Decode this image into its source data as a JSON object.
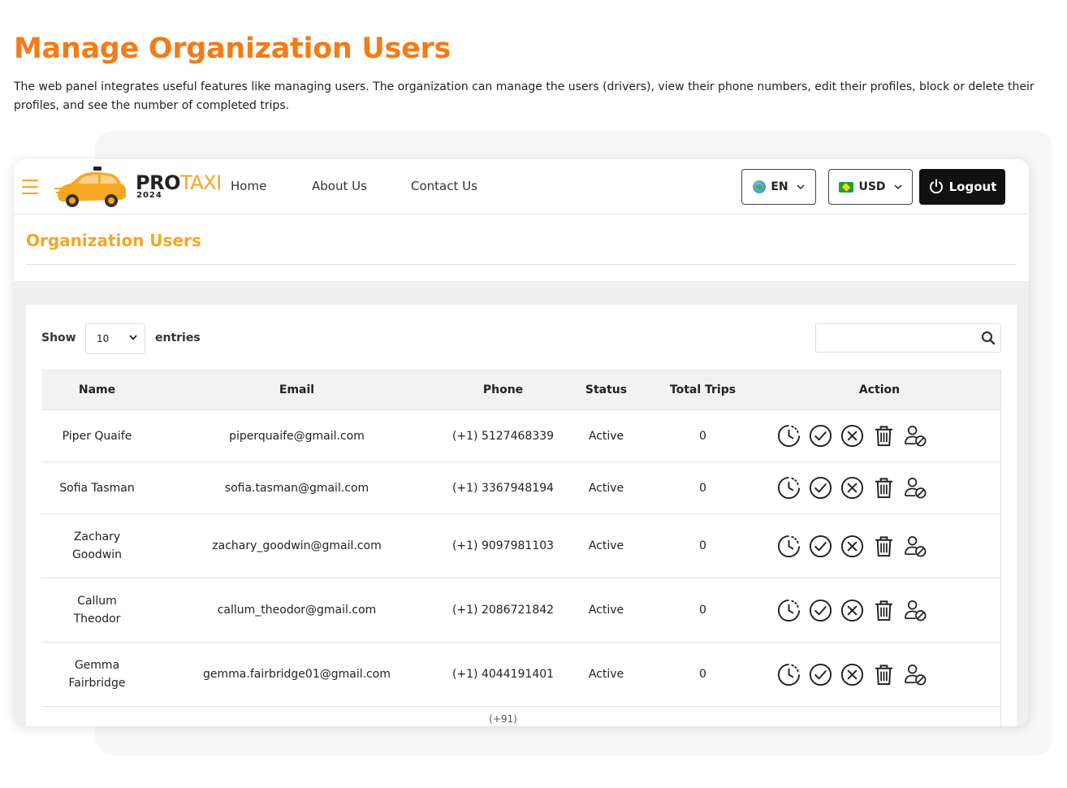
{
  "hero": {
    "title": "Manage Organization Users",
    "description": "The web panel integrates useful features like managing users. The organization can manage the users (drivers), view their phone numbers, edit their profiles, block or delete their profiles, and see the number of completed trips."
  },
  "navbar": {
    "logo_pro": "PRO",
    "logo_taxi": "TAXI",
    "logo_year": "2024",
    "links": [
      "Home",
      "About Us",
      "Contact Us"
    ],
    "language": "EN",
    "currency": "USD",
    "logout_label": "Logout"
  },
  "page": {
    "title": "Organization Users"
  },
  "table_controls": {
    "show_label": "Show",
    "entries_value": "10",
    "entries_label": "entries",
    "search_value": ""
  },
  "table": {
    "headers": [
      "Name",
      "Email",
      "Phone",
      "Status",
      "Total Trips",
      "Action"
    ],
    "rows": [
      {
        "name": "Piper Quaife",
        "email": "piperquaife@gmail.com",
        "phone": "(+1) 5127468339",
        "status": "Active",
        "trips": "0"
      },
      {
        "name": "Sofia Tasman",
        "email": "sofia.tasman@gmail.com",
        "phone": "(+1) 3367948194",
        "status": "Active",
        "trips": "0"
      },
      {
        "name": "Zachary Goodwin",
        "email": "zachary_goodwin@gmail.com",
        "phone": "(+1) 9097981103",
        "status": "Active",
        "trips": "0"
      },
      {
        "name": "Callum Theodor",
        "email": "callum_theodor@gmail.com",
        "phone": "(+1) 2086721842",
        "status": "Active",
        "trips": "0"
      },
      {
        "name": "Gemma Fairbridge",
        "email": "gemma.fairbridge01@gmail.com",
        "phone": "(+1) 4044191401",
        "status": "Active",
        "trips": "0"
      }
    ],
    "partial_row_phone": "(+91)"
  },
  "icons": {
    "menu": "hamburger-icon",
    "globe": "globe-flag-icon",
    "currency_flag": "brazil-flag-icon",
    "power": "power-icon",
    "search": "search-icon",
    "actions": [
      "history-icon",
      "approve-icon",
      "reject-icon",
      "delete-icon",
      "block-user-icon"
    ]
  },
  "colors": {
    "hero_orange": "#f47b16",
    "brand_yellow": "#f5a623",
    "logout_bg": "#111111"
  }
}
